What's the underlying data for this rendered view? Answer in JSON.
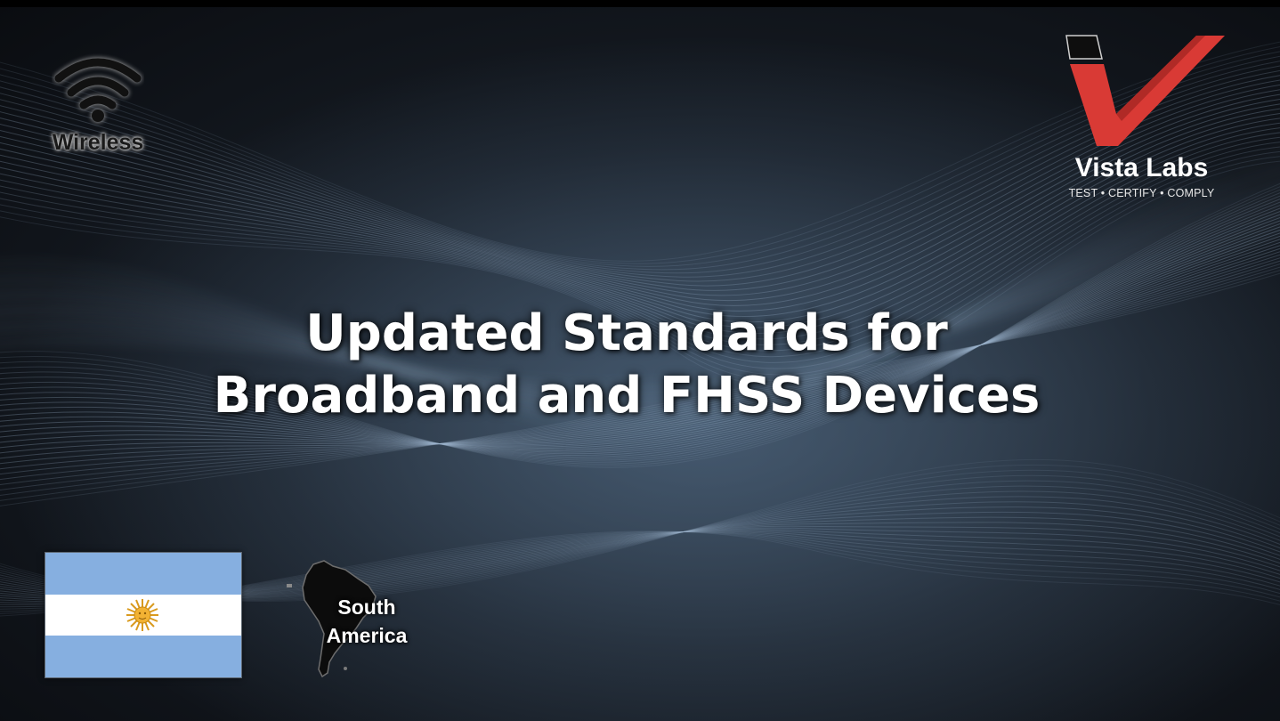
{
  "title": {
    "line1": "Updated Standards for",
    "line2": "Broadband and FHSS Devices"
  },
  "category": {
    "icon": "wifi-icon",
    "label": "Wireless"
  },
  "brand": {
    "logo_icon": "vista-labs-check-logo",
    "name": "Vista Labs",
    "tagline": "TEST • CERTIFY • COMPLY",
    "accent_color": "#d93a35"
  },
  "country": {
    "flag_icon": "argentina-flag",
    "flag_colors": {
      "sky_blue": "#86afe0",
      "white": "#ffffff",
      "sun": "#f2b233"
    }
  },
  "region": {
    "icon": "south-america-map-icon",
    "label_line1": "South",
    "label_line2": "America"
  },
  "colors": {
    "background": "#0b0d10",
    "wave": "#9fb6cf"
  }
}
